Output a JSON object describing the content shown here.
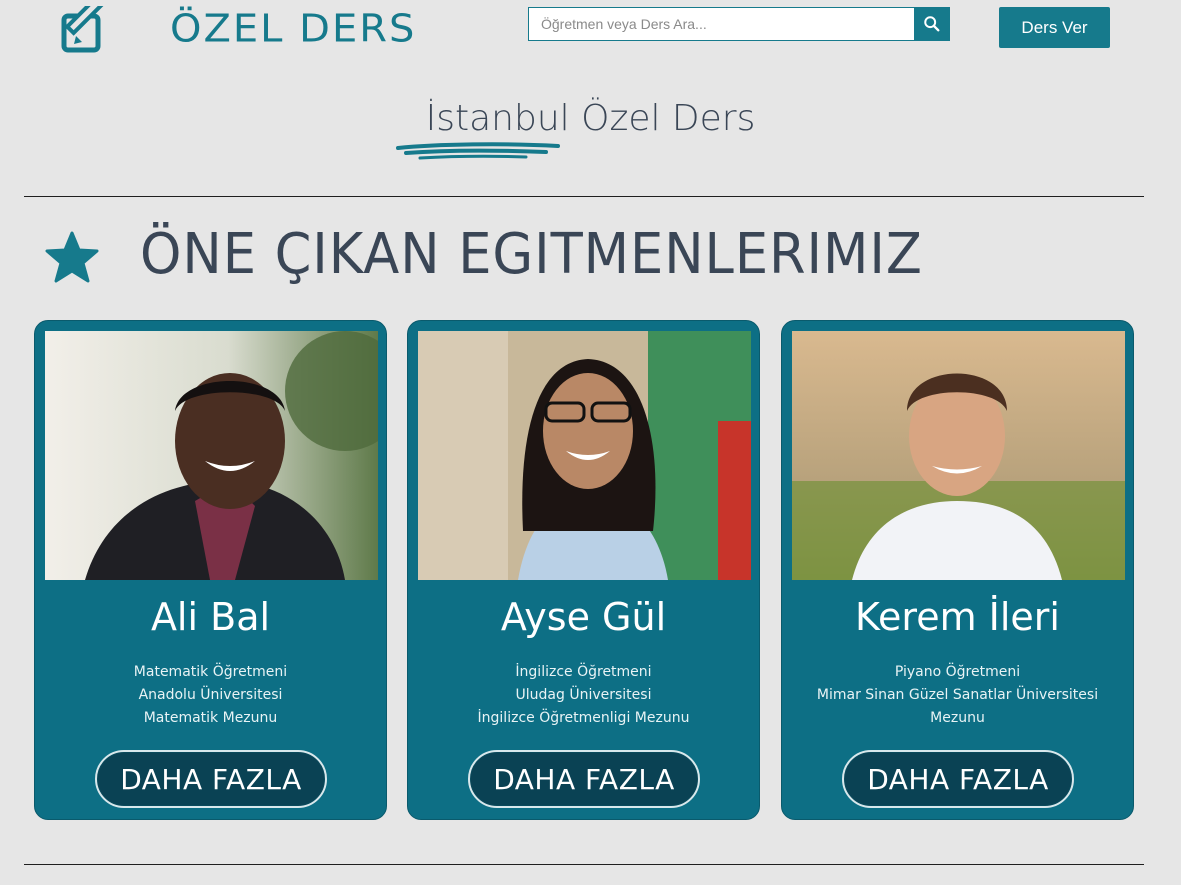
{
  "header": {
    "logo_icon": "edit-pencil-icon",
    "brand": "ÖZEL DERS",
    "search": {
      "placeholder": "Öğretmen veya Ders Ara...",
      "value": "",
      "icon": "search-icon"
    },
    "cta_label": "Ders Ver"
  },
  "city_title": {
    "city": "İstanbul",
    "rest": "Özel Ders"
  },
  "featured": {
    "icon": "star-icon",
    "title": "ÖNE ÇIKAN EGITMENLERIMIZ",
    "cards": [
      {
        "name": "Ali Bal",
        "lines": [
          "Matematik Öğretmeni",
          "Anadolu Üniversitesi",
          "Matematik Mezunu"
        ],
        "button": "DAHA FAZLA"
      },
      {
        "name": "Ayse Gül",
        "lines": [
          "İngilizce Öğretmeni",
          "Uludag Üniversitesi",
          "İngilizce Öğretmenligi Mezunu"
        ],
        "button": "DAHA FAZLA"
      },
      {
        "name": "Kerem İleri",
        "lines": [
          "Piyano Öğretmeni",
          "Mimar Sinan Güzel Sanatlar Üniversitesi",
          "Mezunu"
        ],
        "button": "DAHA FAZLA"
      }
    ]
  },
  "colors": {
    "accent": "#167a8c",
    "card_bg": "#0d6f85",
    "button_bg": "#0a4254",
    "page_bg": "#e6e6e6",
    "text_dark": "#3a4656"
  }
}
